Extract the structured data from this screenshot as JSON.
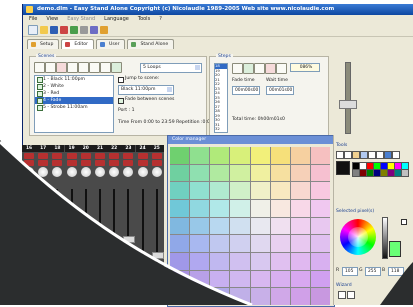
{
  "window": {
    "title": "demo.dlm - Easy Stand Alone   Copyright (c) Nicolaudie 1989-2005   Web site www.nicolaudie.com"
  },
  "menu": [
    "File",
    "View",
    "Easy Stand",
    "Language",
    "Tools",
    "?"
  ],
  "tabs": [
    {
      "label": "Setup"
    },
    {
      "label": "Editor"
    },
    {
      "label": "User"
    },
    {
      "label": "Stand Alone"
    }
  ],
  "scenes": {
    "group_label": "Scenes",
    "loops": "5 Loops",
    "items": [
      {
        "label": "1 - Black 11:00pm",
        "selected": false
      },
      {
        "label": "2 - White",
        "selected": false
      },
      {
        "label": "3 - Red",
        "selected": false
      },
      {
        "label": "4 - Fade",
        "selected": true
      },
      {
        "label": "5 - Strobe 11:00am",
        "selected": false
      }
    ],
    "jump_to_scene_label": "Jump to scene:",
    "jump_target": "Black 11:00pm",
    "fade_between_label": "Fade between scenes",
    "port": "Port : 1",
    "time_info": "Time From 0:00  to  23:59 Repetition :0:00"
  },
  "steps": {
    "group_label": "Steps",
    "numbers": [
      "18",
      "19",
      "20",
      "21",
      "22",
      "23",
      "24",
      "25",
      "26",
      "27",
      "28",
      "29",
      "30",
      "31",
      "32"
    ],
    "selected_number": "18",
    "fade_time_label": "Fade time",
    "wait_time_label": "Wait time",
    "fade_time": "00m00s00",
    "wait_time": "00m01s00",
    "total_time": "Total time: 0h00m01s0",
    "percent": "086%"
  },
  "channels": {
    "numbers": [
      "16",
      "17",
      "18",
      "19",
      "20",
      "21",
      "22",
      "23",
      "24",
      "25"
    ],
    "levels": [
      0.45,
      0.7,
      0.3,
      0.5,
      0.2,
      0.6,
      0.35,
      0.55,
      0.25,
      0.4
    ]
  },
  "color_manager": {
    "title": "Color manager",
    "rows": [
      [
        "#6fd06f",
        "#8fe08f",
        "#b0ea7a",
        "#d8f07a",
        "#f2f07a",
        "#f6e07a",
        "#f6d0a0",
        "#f6c0c0"
      ],
      [
        "#6fd0a0",
        "#8fe0b0",
        "#b0eaa0",
        "#d0f0a0",
        "#f0f0a0",
        "#f6e0a0",
        "#f6d0b8",
        "#f6c0d0"
      ],
      [
        "#70d0c0",
        "#90e0d0",
        "#b0ead0",
        "#d0f0c8",
        "#f0f0c8",
        "#f8e8c0",
        "#f8d8d0",
        "#f8c8e0"
      ],
      [
        "#70c8d8",
        "#90d8e0",
        "#b0e8e8",
        "#d0f0e8",
        "#f0f0e8",
        "#f8e8e0",
        "#f8d8e8",
        "#f0c8f0"
      ],
      [
        "#80b8e0",
        "#98c8e8",
        "#b8d8f0",
        "#d0e0f0",
        "#e8e8f0",
        "#f0e0f0",
        "#f0d0f0",
        "#e8c8f0"
      ],
      [
        "#90a8e8",
        "#a8b8f0",
        "#c0c8f0",
        "#d0d0f0",
        "#e0d8f0",
        "#e8d0f0",
        "#e8c8f0",
        "#e0c0f0"
      ],
      [
        "#a098e8",
        "#b0a8f0",
        "#c0b8f0",
        "#d0c0f0",
        "#d8c8f0",
        "#e0c0f0",
        "#e0b8f0",
        "#d8b0f0"
      ],
      [
        "#a890e0",
        "#b8a0e8",
        "#c8b0f0",
        "#d0b8f0",
        "#d8b8f0",
        "#d8b0f0",
        "#d8a8f0",
        "#d0a0f0"
      ],
      [
        "#9088d8",
        "#a098e0",
        "#b0a8e8",
        "#c0b0e8",
        "#c8b0e8",
        "#d0a8e8",
        "#d0a0e8",
        "#c898e0"
      ]
    ]
  },
  "tools": {
    "tools_label": "Tools",
    "selected_pixels_label": "Selected pixel(s)",
    "wizard_label": "Wizard",
    "r_label": "R",
    "g_label": "G",
    "b_label": "B",
    "r": "105",
    "g": "255",
    "b": "118",
    "palette": [
      "#000000",
      "#ffffff",
      "#ff0000",
      "#00ff00",
      "#0000ff",
      "#ffff00",
      "#ff00ff",
      "#00ffff",
      "#808080",
      "#800000",
      "#008000",
      "#000080",
      "#808000",
      "#800080",
      "#008080",
      "#c0c0c0"
    ]
  }
}
